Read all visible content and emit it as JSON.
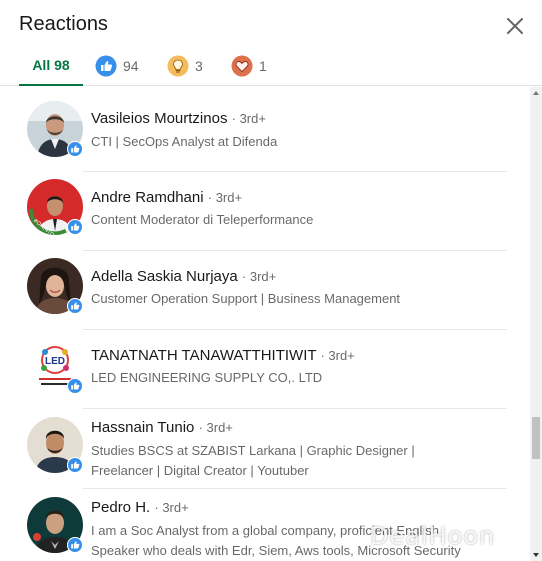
{
  "header": {
    "title": "Reactions",
    "close_icon": "close-icon"
  },
  "tabs": [
    {
      "label": "All 98",
      "active": true
    },
    {
      "icon": "like-icon",
      "count": "94",
      "color": "#378fe9"
    },
    {
      "icon": "insightful-icon",
      "count": "3",
      "color": "#f5bb5c"
    },
    {
      "icon": "love-icon",
      "count": "1",
      "color": "#df704d"
    }
  ],
  "people": [
    {
      "name": "Vasileios Mourtzinos",
      "degree": "· 3rd+",
      "headline": "CTI | SecOps Analyst at Difenda",
      "reaction": "like-icon"
    },
    {
      "name": "Andre Ramdhani",
      "degree": "· 3rd+",
      "headline": "Content Moderator di Teleperformance",
      "reaction": "like-icon",
      "avatar_frame": "#OPENTOWORK"
    },
    {
      "name": "Adella Saskia Nurjaya",
      "degree": "· 3rd+",
      "headline": "Customer Operation Support | Business Management",
      "reaction": "like-icon"
    },
    {
      "name": "TANATNATH TANAWATTHITIWIT",
      "degree": "· 3rd+",
      "headline": "LED ENGINEERING SUPPLY CO,. LTD",
      "reaction": "like-icon",
      "avatar_logo": "LED"
    },
    {
      "name": "Hassnain Tunio",
      "degree": "· 3rd+",
      "headline_lines": [
        "Studies BSCS at SZABIST Larkana | Graphic Designer |",
        "Freelancer | Digital Creator | Youtuber"
      ],
      "reaction": "like-icon"
    },
    {
      "name": "Pedro H.",
      "degree": "· 3rd+",
      "headline_lines": [
        "I am a Soc Analyst from a global company, proficient English",
        "Speaker who deals with Edr, Siem, Aws tools, Microsoft Security"
      ],
      "reaction": "like-icon"
    }
  ],
  "watermark": "DealHoon",
  "colors": {
    "accent_green": "#057642",
    "like_blue": "#378fe9"
  }
}
